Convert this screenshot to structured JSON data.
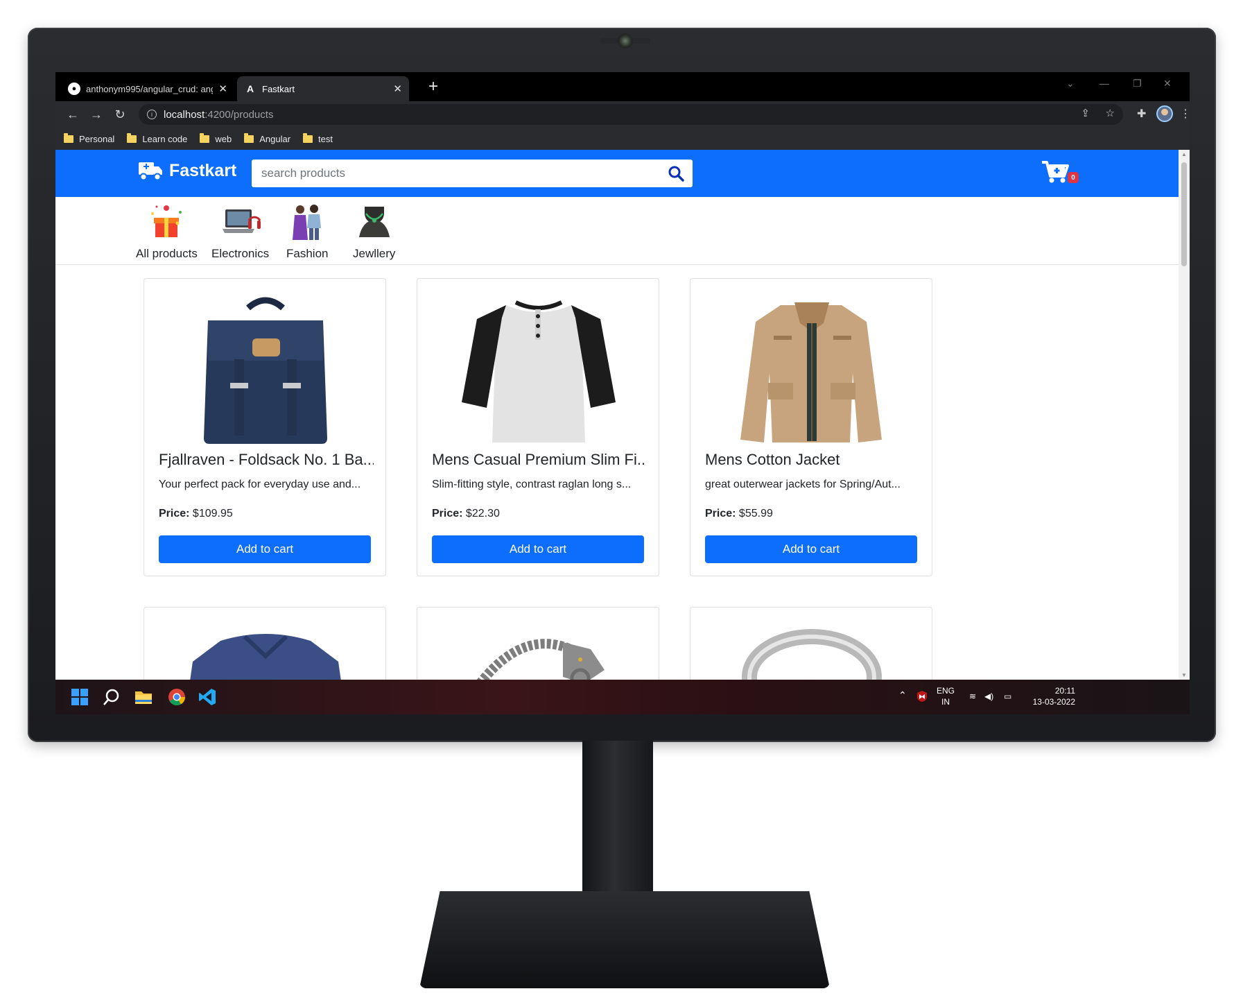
{
  "browser": {
    "tabs": [
      {
        "title": "anthonym995/angular_crud: ang",
        "icon": "github-icon"
      },
      {
        "title": "Fastkart",
        "icon": "angular-icon"
      }
    ],
    "url_host": "localhost",
    "url_path": ":4200/products",
    "bookmarks": [
      "Personal",
      "Learn code",
      "web",
      "Angular",
      "test"
    ]
  },
  "app": {
    "brand": "Fastkart",
    "search_placeholder": "search products",
    "cart_count": "0",
    "categories": [
      "All products",
      "Electronics",
      "Fashion",
      "Jewllery"
    ],
    "price_label": "Price:",
    "add_to_cart_label": "Add to cart",
    "products": [
      {
        "title": "Fjallraven - Foldsack No. 1 Ba...",
        "description": "Your perfect pack for everyday use and...",
        "price": "$109.95"
      },
      {
        "title": "Mens Casual Premium Slim Fi...",
        "description": "Slim-fitting style, contrast raglan long s...",
        "price": "$22.30"
      },
      {
        "title": "Mens Cotton Jacket",
        "description": "great outerwear jackets for Spring/Aut...",
        "price": "$55.99"
      }
    ]
  },
  "taskbar": {
    "language": "ENG",
    "region": "IN",
    "time": "20:11",
    "date": "13-03-2022"
  },
  "colors": {
    "primary": "#0d6efd",
    "badge": "#dc3545"
  }
}
